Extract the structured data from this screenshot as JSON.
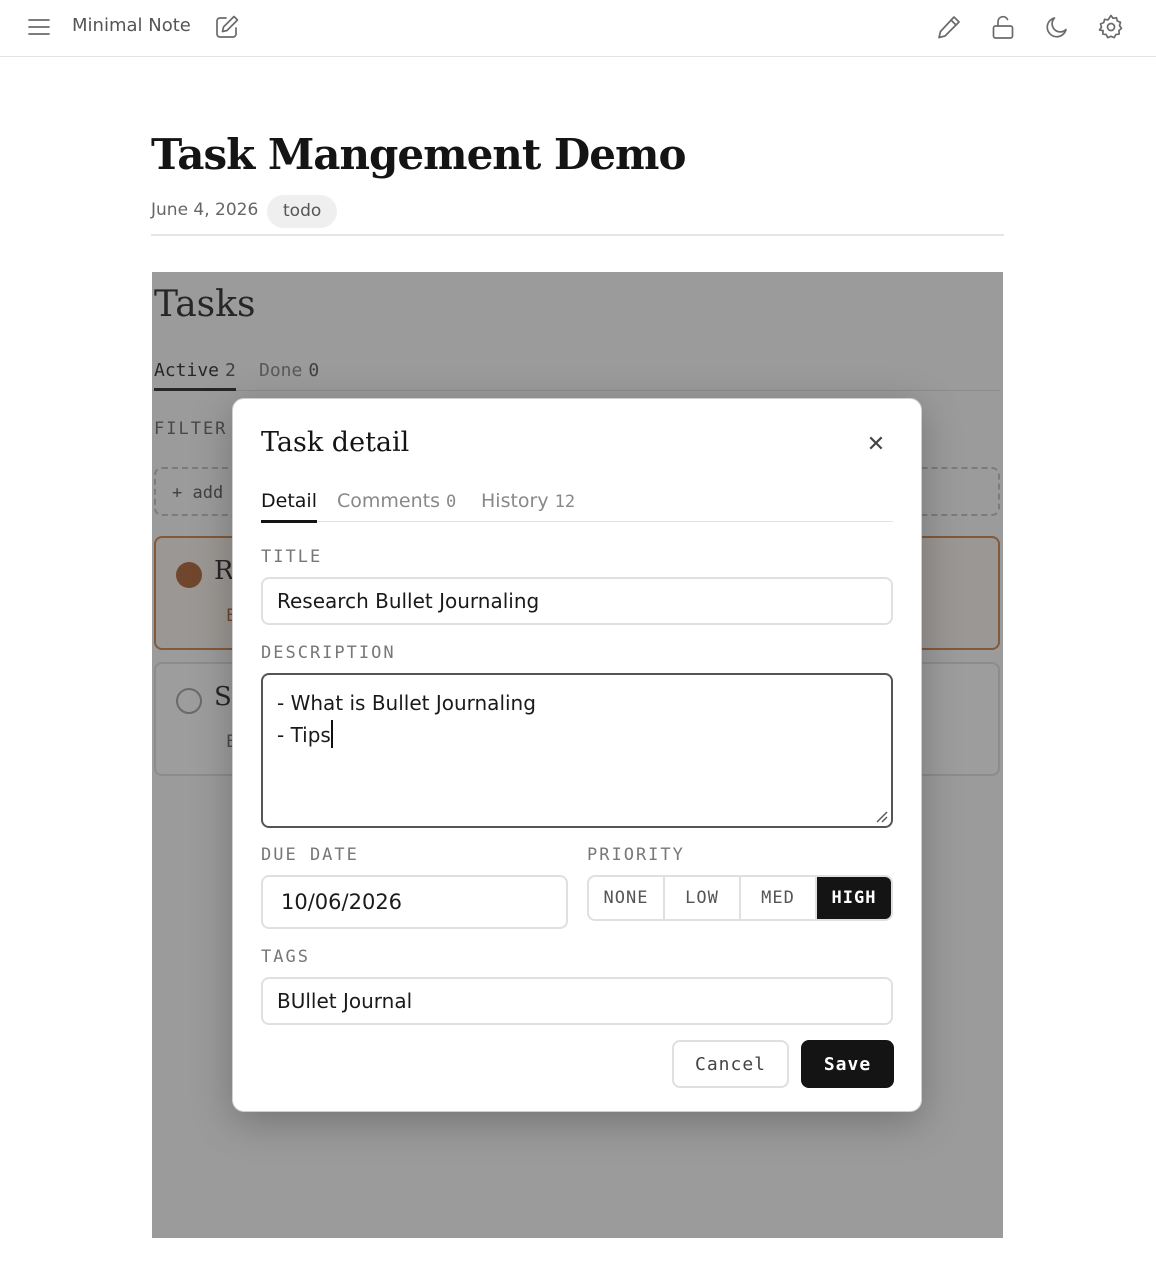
{
  "app": {
    "name": "Minimal Note",
    "icons": [
      "menu-icon",
      "compose-icon",
      "edit-pencil-icon",
      "unlock-icon",
      "moon-icon",
      "gear-icon"
    ]
  },
  "note": {
    "title": "Task Mangement Demo",
    "date": "June 4, 2026",
    "tag": "todo"
  },
  "tasks_widget": {
    "title": "Tasks",
    "tabs": [
      {
        "label": "Active",
        "count": "2"
      },
      {
        "label": "Done",
        "count": "0"
      }
    ],
    "filter_label": "FILTER",
    "add_label": "+ add",
    "cards": [
      {
        "title_initial": "R",
        "sub_initial": "E"
      },
      {
        "title_initial": "St",
        "sub_initial": "E"
      }
    ]
  },
  "modal": {
    "title": "Task detail",
    "close_glyph": "✕",
    "tabs": [
      {
        "label": "Detail",
        "count": ""
      },
      {
        "label": "Comments",
        "count": "0"
      },
      {
        "label": "History",
        "count": "12"
      }
    ],
    "fields": {
      "title_label": "TITLE",
      "title_value": "Research Bullet Journaling",
      "description_label": "DESCRIPTION",
      "description_value": "- What is Bullet Journaling\n- Tips",
      "due_label": "DUE DATE",
      "due_value": "10/06/2026",
      "priority_label": "PRIORITY",
      "priority_options": [
        "NONE",
        "LOW",
        "MED",
        "HIGH"
      ],
      "priority_selected": "HIGH",
      "tags_label": "TAGS",
      "tags_value": "BUllet Journal"
    },
    "buttons": {
      "cancel": "Cancel",
      "save": "Save"
    }
  },
  "colors": {
    "accent_dark": "#141414",
    "task_accent": "#a4521f",
    "overlay": "rgba(60,60,60,0.5)"
  }
}
